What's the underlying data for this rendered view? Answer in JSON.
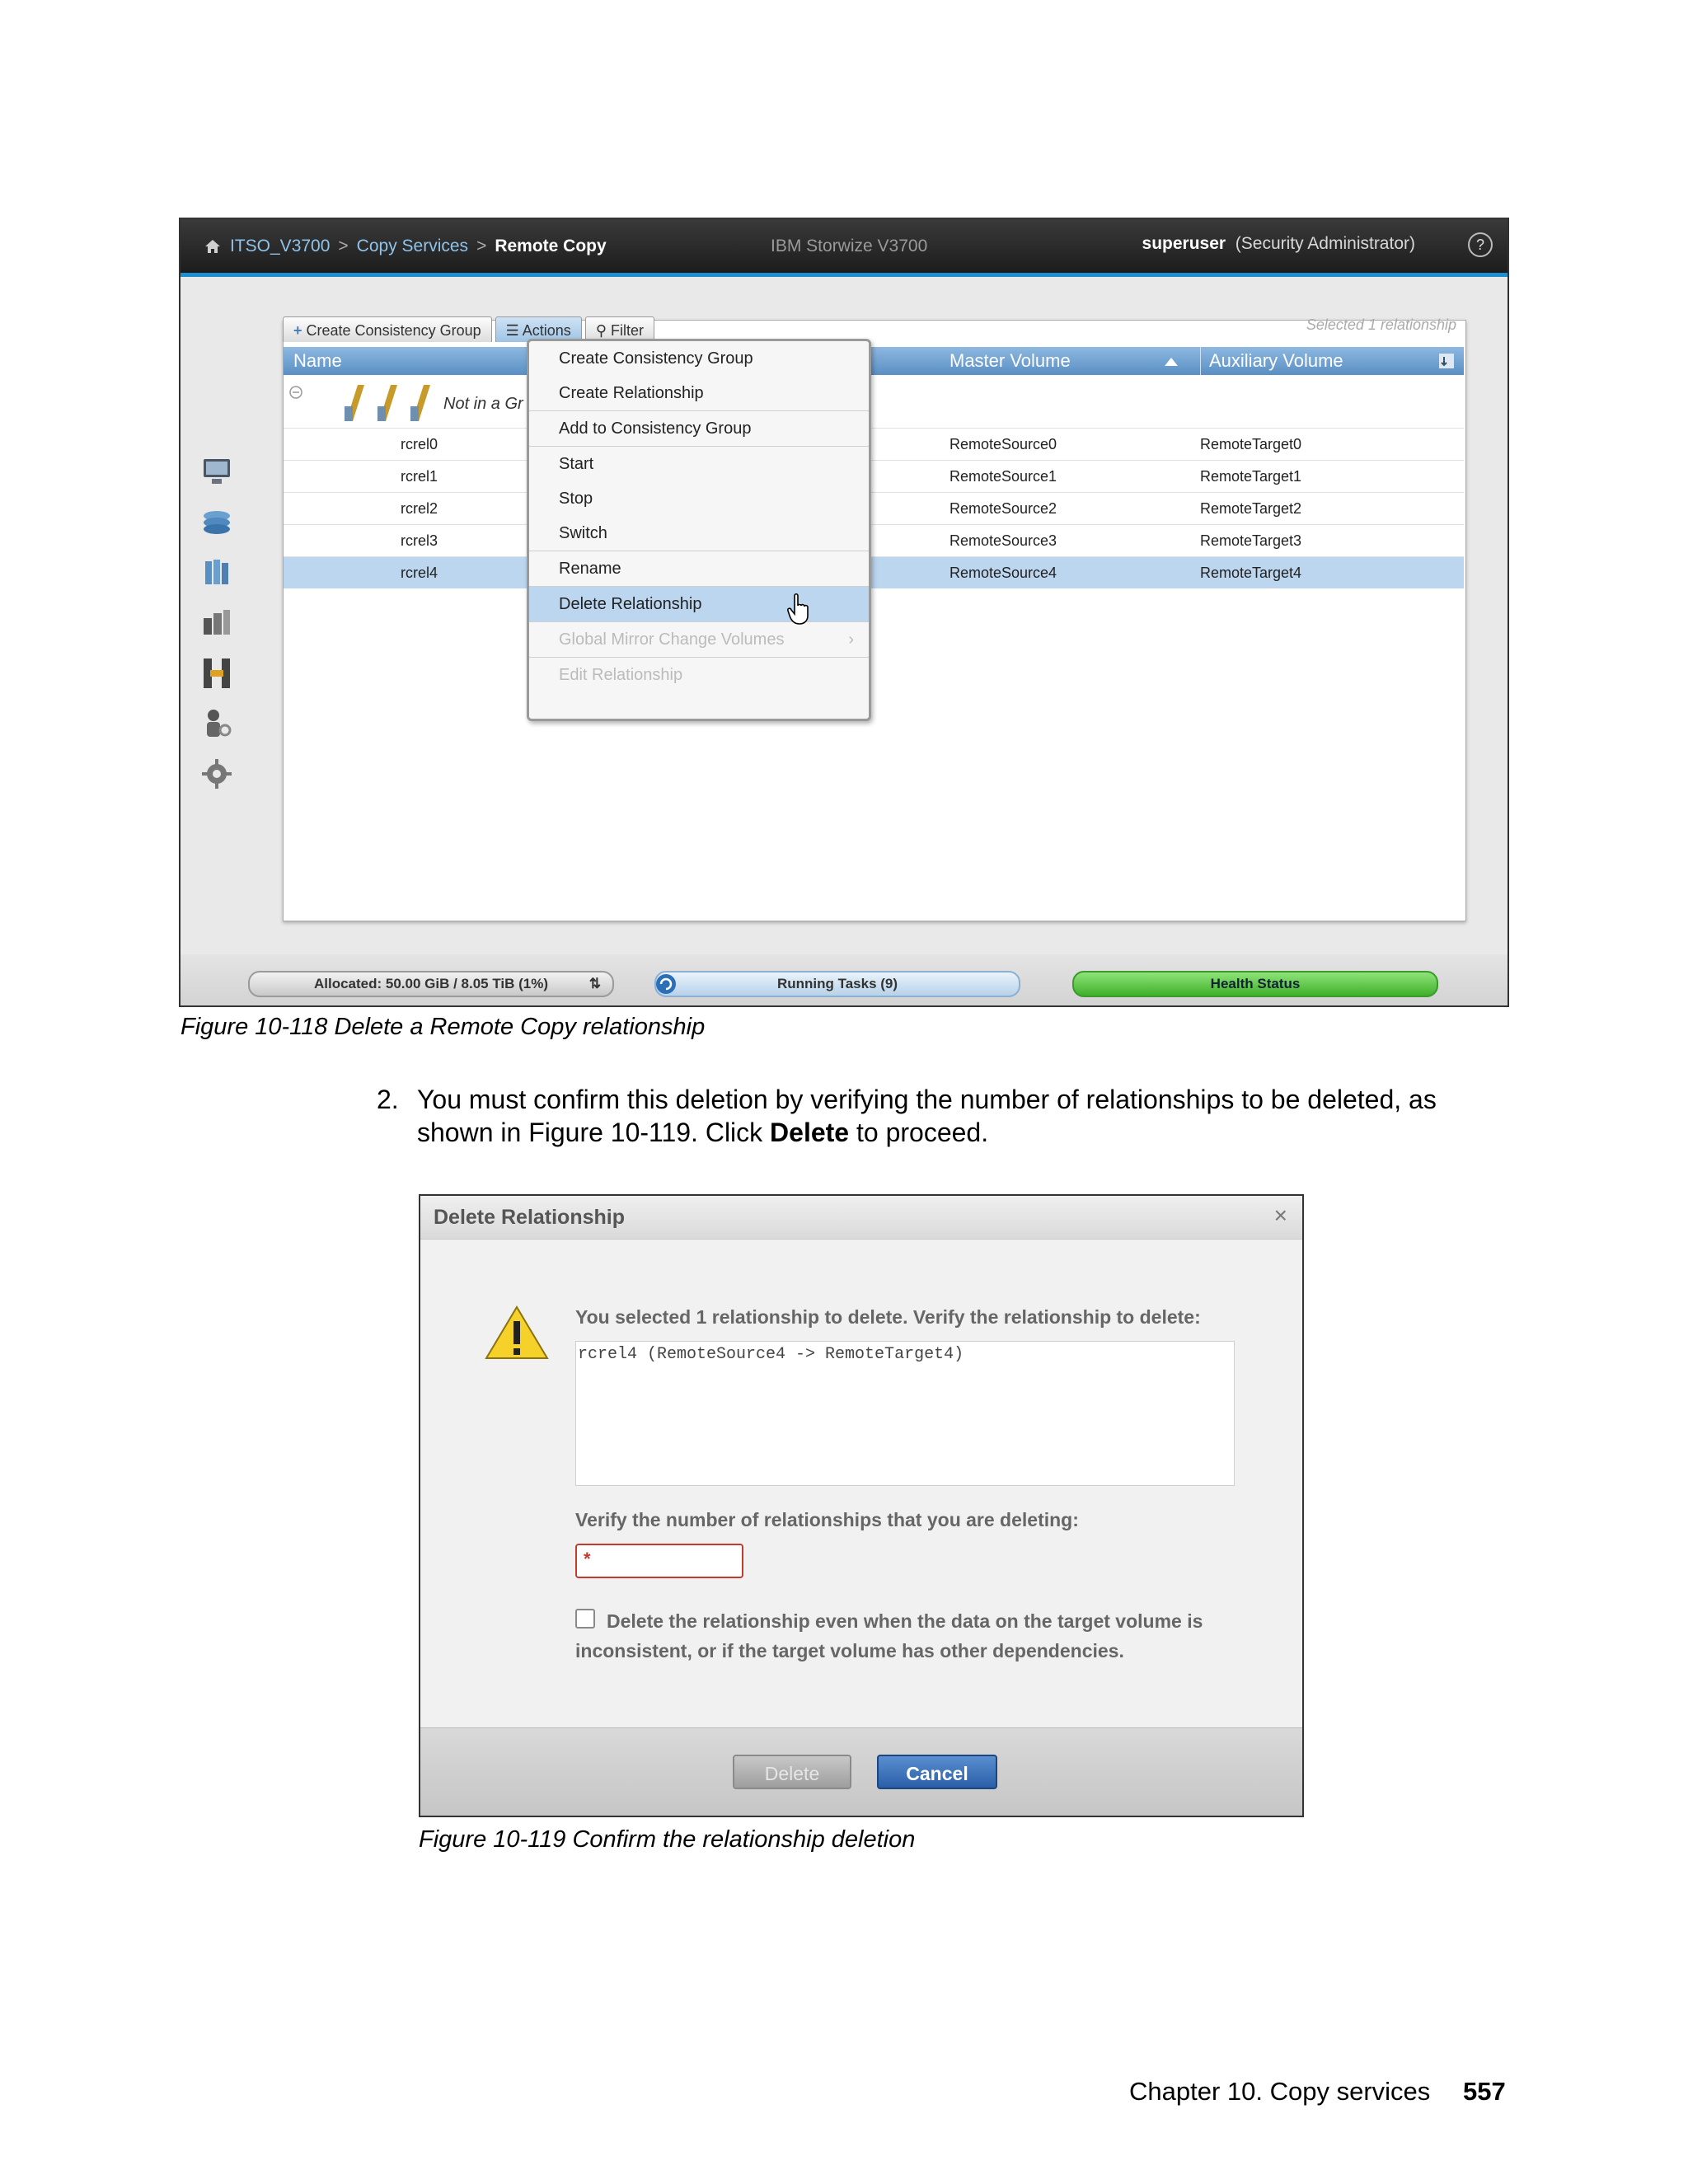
{
  "figure1": {
    "breadcrumb": [
      "ITSO_V3700",
      "Copy Services",
      "Remote Copy"
    ],
    "product": "IBM Storwize V3700",
    "user": "superuser",
    "role": "(Security Administrator)",
    "help": "?",
    "tabs": [
      "Create Consistency Group",
      "Actions",
      "Filter"
    ],
    "selected_note": "Selected 1 relationship",
    "columns": [
      "Name",
      "Master Volume",
      "Auxiliary Volume"
    ],
    "group_label": "Not in a Gr",
    "rows": [
      {
        "name": "rcrel0",
        "master": "RemoteSource0",
        "aux": "RemoteTarget0"
      },
      {
        "name": "rcrel1",
        "master": "RemoteSource1",
        "aux": "RemoteTarget1"
      },
      {
        "name": "rcrel2",
        "master": "RemoteSource2",
        "aux": "RemoteTarget2"
      },
      {
        "name": "rcrel3",
        "master": "RemoteSource3",
        "aux": "RemoteTarget3"
      },
      {
        "name": "rcrel4",
        "master": "RemoteSource4",
        "aux": "RemoteTarget4"
      }
    ],
    "menu": [
      "Create Consistency Group",
      "Create Relationship",
      "Add to Consistency Group",
      "Start",
      "Stop",
      "Switch",
      "Rename",
      "Delete Relationship",
      "Global Mirror Change Volumes",
      "Edit Relationship"
    ],
    "status": {
      "allocated": "Allocated: 50.00 GiB / 8.05 TiB (1%)",
      "tasks": "Running Tasks (9)",
      "health": "Health Status"
    },
    "caption": "Figure 10-118   Delete a Remote Copy relationship"
  },
  "step": {
    "number": "2.",
    "text_before": "You must confirm this deletion by verifying the number of relationships to be deleted, as shown in Figure 10-119. Click ",
    "text_bold": "Delete",
    "text_after": " to proceed."
  },
  "figure2": {
    "title": "Delete Relationship",
    "close": "×",
    "message": "You selected 1 relationship to delete. Verify the relationship to delete:",
    "list_item": "rcrel4 (RemoteSource4 -> RemoteTarget4)",
    "verify_label": "Verify the number of relationships that you are deleting:",
    "required_mark": "*",
    "checkbox_label": "Delete the relationship even when the data on the target volume is inconsistent, or if the target volume has other dependencies.",
    "delete_button": "Delete",
    "cancel_button": "Cancel",
    "caption": "Figure 10-119   Confirm the relationship deletion"
  },
  "footer": {
    "chapter": "Chapter 10. Copy services",
    "page": "557"
  },
  "colors": {
    "accent": "#1d8fcf",
    "selection": "#bcd6f0",
    "required": "#c23b2c",
    "health": "#3fb02a"
  }
}
